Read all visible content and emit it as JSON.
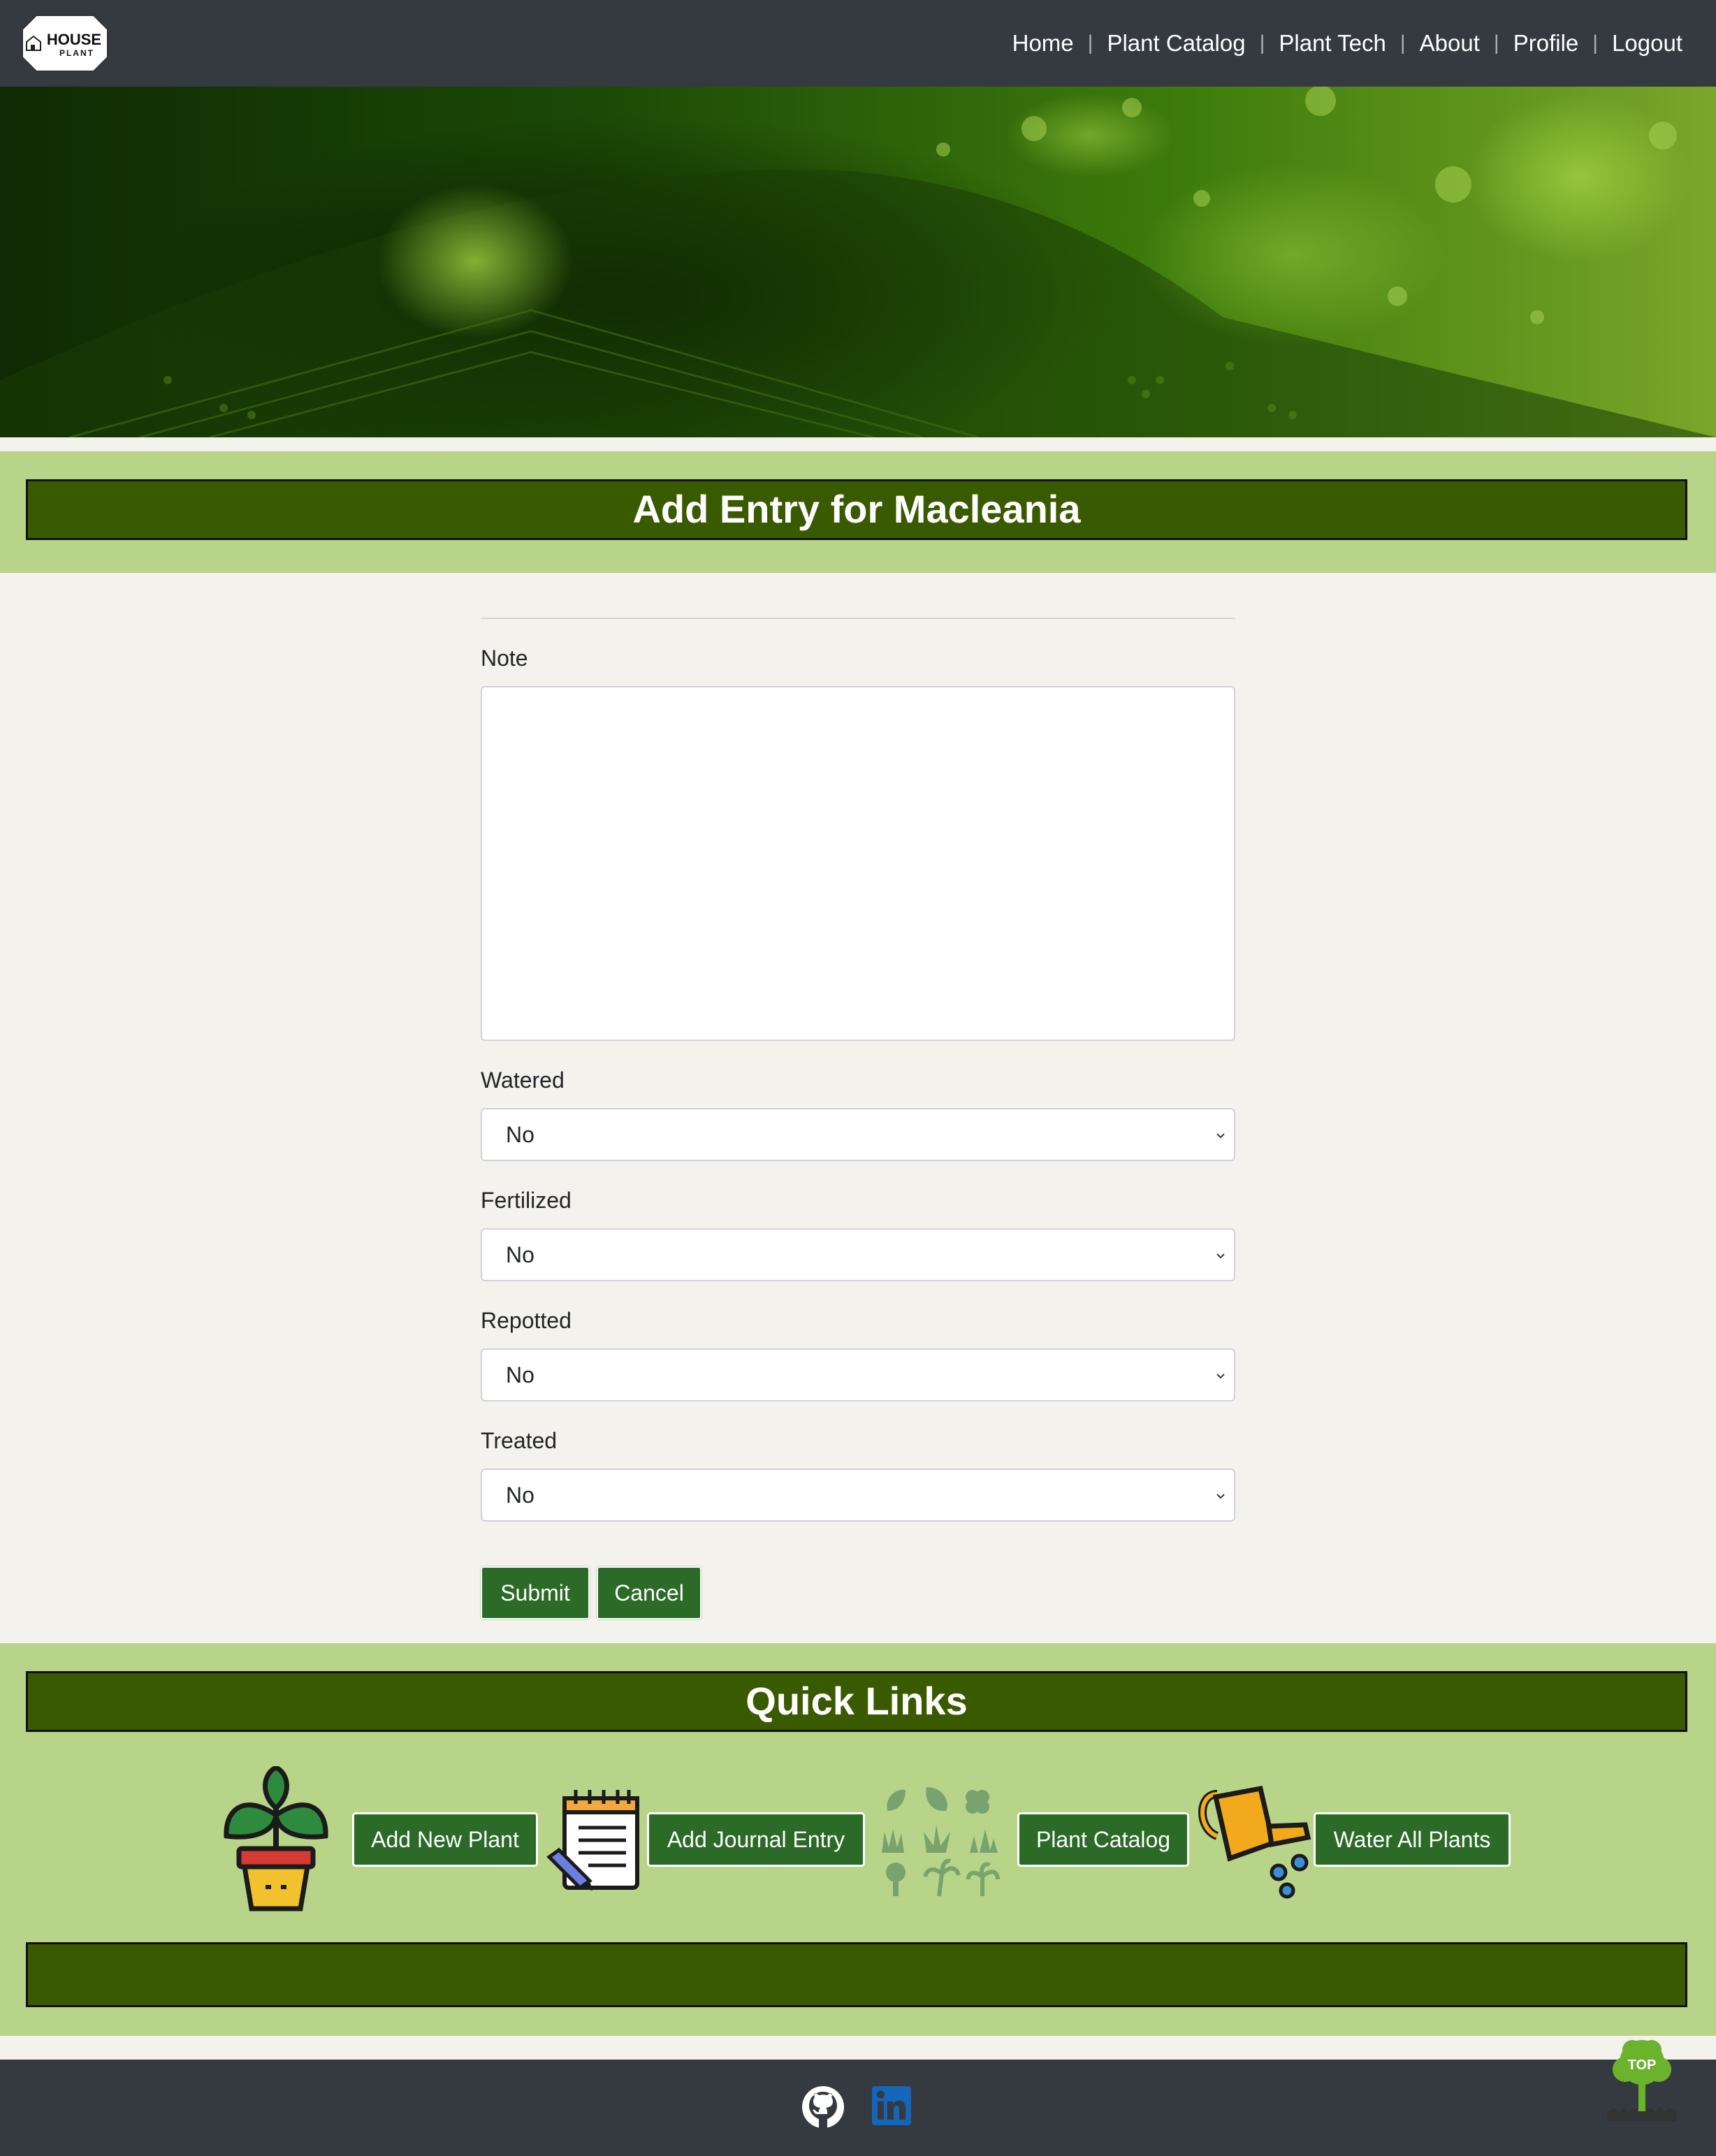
{
  "brand": {
    "line1": "HOUSE",
    "line2": "PLANT"
  },
  "nav": {
    "items": [
      {
        "label": "Home"
      },
      {
        "label": "Plant Catalog"
      },
      {
        "label": "Plant Tech"
      },
      {
        "label": "About"
      },
      {
        "label": "Profile"
      },
      {
        "label": "Logout"
      }
    ],
    "separator": "|"
  },
  "page": {
    "title": "Add Entry for Macleania"
  },
  "form": {
    "note": {
      "label": "Note",
      "value": ""
    },
    "watered": {
      "label": "Watered",
      "value": "No"
    },
    "fertilized": {
      "label": "Fertilized",
      "value": "No"
    },
    "repotted": {
      "label": "Repotted",
      "value": "No"
    },
    "treated": {
      "label": "Treated",
      "value": "No"
    },
    "submit_label": "Submit",
    "cancel_label": "Cancel"
  },
  "quick_links": {
    "title": "Quick Links",
    "items": [
      {
        "label": "Add New Plant",
        "icon": "potted-plant-icon"
      },
      {
        "label": "Add Journal Entry",
        "icon": "notepad-pencil-icon"
      },
      {
        "label": "Plant Catalog",
        "icon": "plant-types-icon"
      },
      {
        "label": "Water All Plants",
        "icon": "watering-can-icon"
      }
    ]
  },
  "footer": {
    "icons": [
      "github-icon",
      "linkedin-icon"
    ]
  },
  "back_to_top": {
    "label": "TOP"
  },
  "colors": {
    "navbar": "#343a40",
    "band": "#b8d488",
    "title_box": "#3a5a00",
    "button": "#2b6a27",
    "page_bg": "#f4f2ec"
  }
}
